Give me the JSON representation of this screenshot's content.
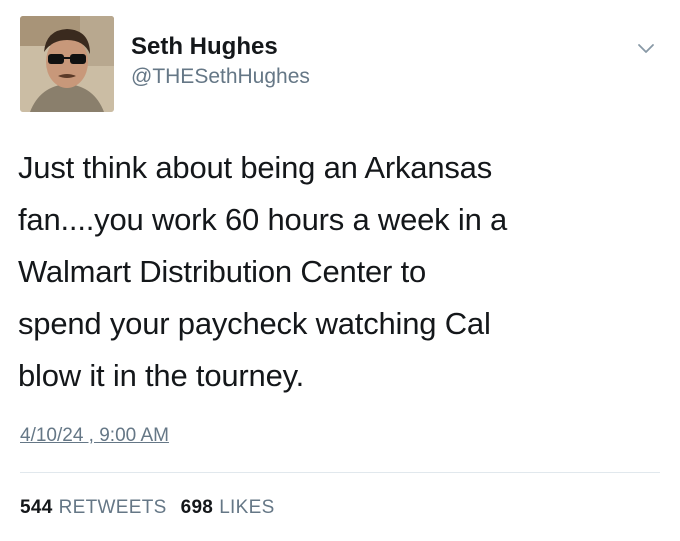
{
  "author": {
    "name": "Seth Hughes",
    "handle": "@THESethHughes"
  },
  "tweet": {
    "text": "Just think about being an Arkansas\nfan....you work 60 hours a week in a\nWalmart Distribution Center to\nspend your paycheck watching Cal\nblow it in the tourney.",
    "timestamp": "4/10/24 , 9:00 AM"
  },
  "stats": {
    "retweets_count": "544",
    "retweets_label": "RETWEETS",
    "likes_count": "698",
    "likes_label": "LIKES"
  },
  "icons": {
    "menu": "chevron-down-icon"
  },
  "colors": {
    "text": "#14171a",
    "secondary": "#657786",
    "divider": "#e1e8ed"
  }
}
